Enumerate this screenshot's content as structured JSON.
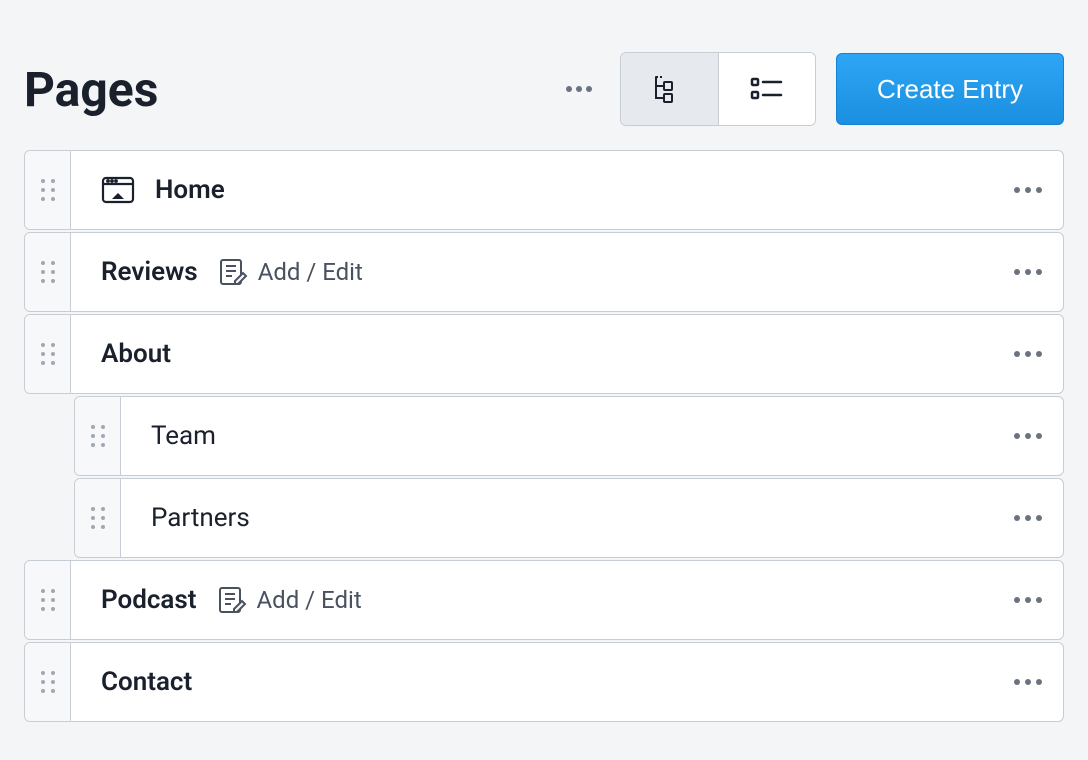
{
  "header": {
    "title": "Pages",
    "create_label": "Create Entry"
  },
  "add_edit_label": "Add / Edit",
  "items": [
    {
      "label": "Home",
      "hasHomeIcon": true,
      "hasAddEdit": false,
      "indent": 0
    },
    {
      "label": "Reviews",
      "hasHomeIcon": false,
      "hasAddEdit": true,
      "indent": 0
    },
    {
      "label": "About",
      "hasHomeIcon": false,
      "hasAddEdit": false,
      "indent": 0
    },
    {
      "label": "Team",
      "hasHomeIcon": false,
      "hasAddEdit": false,
      "indent": 1
    },
    {
      "label": "Partners",
      "hasHomeIcon": false,
      "hasAddEdit": false,
      "indent": 1
    },
    {
      "label": "Podcast",
      "hasHomeIcon": false,
      "hasAddEdit": true,
      "indent": 0
    },
    {
      "label": "Contact",
      "hasHomeIcon": false,
      "hasAddEdit": false,
      "indent": 0
    }
  ]
}
